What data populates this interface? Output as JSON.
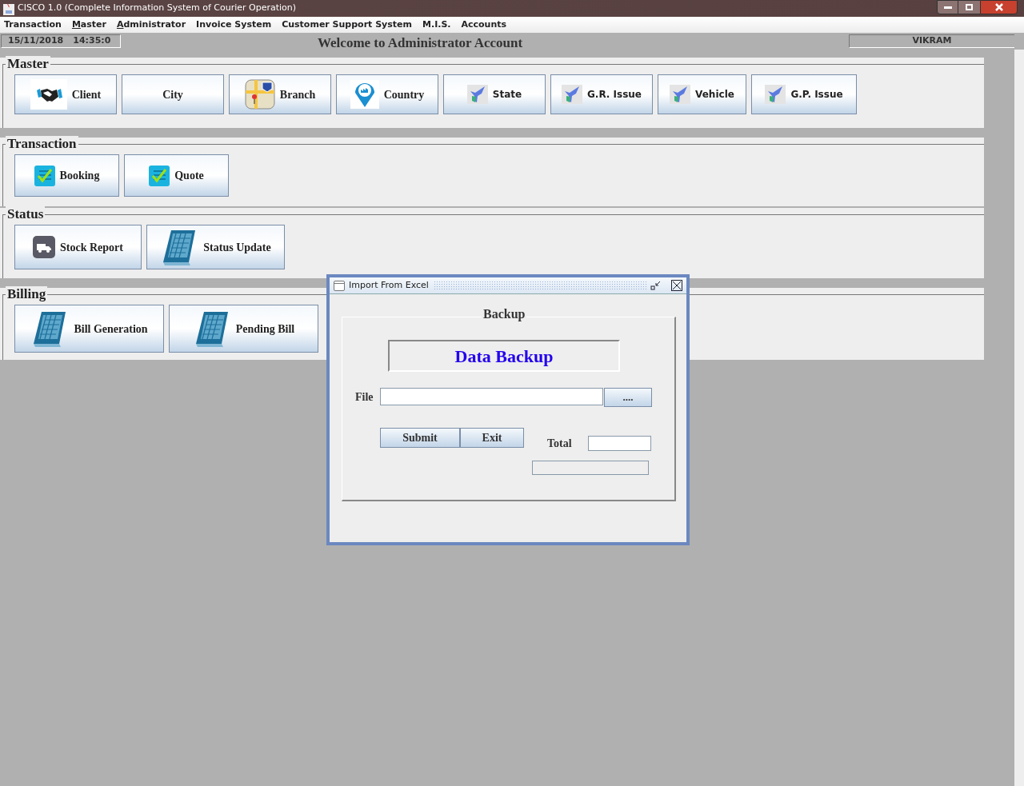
{
  "window": {
    "title": "CISCO 1.0 (Complete Information System of Courier Operation)"
  },
  "menu": [
    {
      "label": "Transaction",
      "mnemonic": false
    },
    {
      "label": "Master",
      "mnemonic": true
    },
    {
      "label": "Administrator",
      "mnemonic": true
    },
    {
      "label": "Invoice System",
      "mnemonic": false
    },
    {
      "label": "Customer Support System",
      "mnemonic": false
    },
    {
      "label": "M.I.S.",
      "mnemonic": false
    },
    {
      "label": "Accounts",
      "mnemonic": false
    }
  ],
  "status_bar": {
    "date": "15/11/2018",
    "time": "14:35:0",
    "welcome": "Welcome to Administrator Account",
    "user": "VIKRAM"
  },
  "sections": [
    {
      "title": "Master",
      "buttons": [
        {
          "label": "Client",
          "kind": "handshake"
        },
        {
          "label": "City",
          "kind": "plain"
        },
        {
          "label": "Branch",
          "kind": "map"
        },
        {
          "label": "Country",
          "kind": "pin"
        },
        {
          "label": "State",
          "kind": "bird"
        },
        {
          "label": "G.R. Issue",
          "kind": "bird"
        },
        {
          "label": "Vehicle",
          "kind": "bird"
        },
        {
          "label": "G.P. Issue",
          "kind": "bird"
        }
      ]
    },
    {
      "title": "Transaction",
      "buttons": [
        {
          "label": "Booking",
          "kind": "checklist"
        },
        {
          "label": "Quote",
          "kind": "checklist"
        }
      ]
    },
    {
      "title": "Status",
      "buttons": [
        {
          "label": "Stock Report",
          "kind": "truck"
        },
        {
          "label": "Status Update",
          "kind": "calendar"
        }
      ]
    },
    {
      "title": "Billing",
      "buttons": [
        {
          "label": "Bill Generation",
          "kind": "calendar"
        },
        {
          "label": "Pending Bill",
          "kind": "calendar"
        }
      ]
    }
  ],
  "dialog": {
    "title": "Import From Excel",
    "group_title": "Backup",
    "heading": "Data Backup",
    "file_label": "File",
    "browse_button": "....",
    "submit_button": "Submit",
    "exit_button": "Exit",
    "total_label": "Total",
    "progress": {
      "level": 0
    }
  }
}
